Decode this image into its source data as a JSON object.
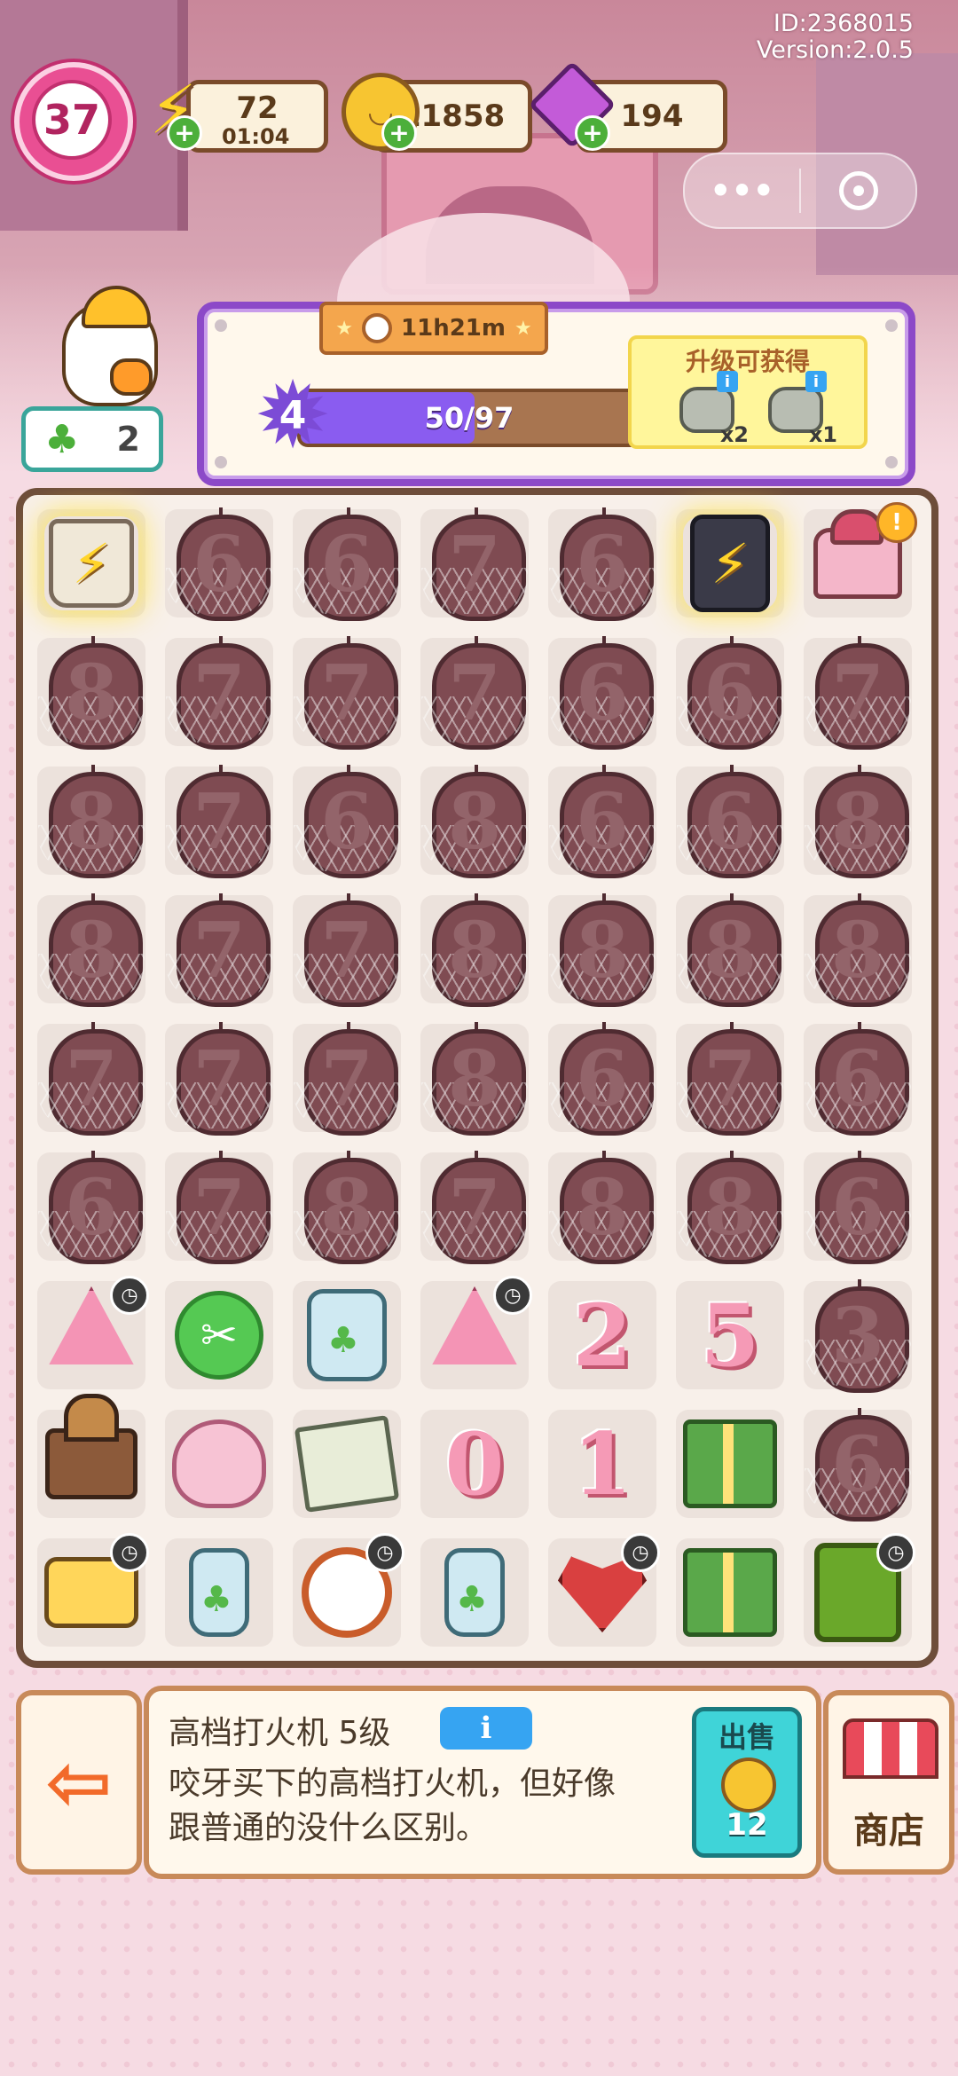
{
  "header": {
    "user_id": "ID:2368015",
    "version": "Version:2.0.5"
  },
  "player": {
    "level": "37"
  },
  "resources": {
    "energy": "72",
    "energy_timer": "01:04",
    "coins": "11858",
    "gems": "194",
    "plus_symbol": "+"
  },
  "capsule": {
    "more": "•••"
  },
  "helper": {
    "clover_count": "2"
  },
  "level_panel": {
    "timer": "11h21m",
    "level": "4",
    "xp_text": "50/97",
    "xp_progress": 0.515,
    "reward_title": "升级可获得",
    "rewards": [
      {
        "icon": "stone-icon",
        "qty": "x2"
      },
      {
        "icon": "stone-icon",
        "qty": "x1"
      }
    ]
  },
  "board": {
    "rows": [
      [
        "planter-generator",
        "6",
        "6",
        "7",
        "6",
        "lighter-generator",
        "cake"
      ],
      [
        "8",
        "7",
        "7",
        "7",
        "6",
        "6",
        "7"
      ],
      [
        "8",
        "7",
        "6",
        "8",
        "6",
        "6",
        "8"
      ],
      [
        "8",
        "7",
        "7",
        "8",
        "8",
        "8",
        "8"
      ],
      [
        "7",
        "7",
        "7",
        "8",
        "6",
        "7",
        "6"
      ],
      [
        "6",
        "7",
        "8",
        "7",
        "8",
        "8",
        "6"
      ],
      [
        "pink-tree",
        "scissors",
        "clover-jar",
        "pink-tree",
        "candle-2",
        "candle-5",
        "3"
      ],
      [
        "music-box",
        "blossom-tree",
        "photo-book",
        "candle-0",
        "candle-1",
        "green-pouch",
        "6"
      ],
      [
        "duck-scale",
        "clover-bottle",
        "alarm-clock",
        "clover-jar-small",
        "bandaged-heart",
        "green-gift",
        "lantern-clock"
      ]
    ],
    "candle_digits": {
      "candle-2": "2",
      "candle-5": "5",
      "candle-0": "0",
      "candle-1": "1"
    },
    "info_symbol": "i",
    "timer_symbol": "◷",
    "alert_symbol": "!"
  },
  "item_info": {
    "name": "高档打火机 5级",
    "info_label": "i",
    "description": "咬牙买下的高档打火机，但好像跟普通的没什么区别。",
    "sell_label": "出售",
    "sell_price": "12"
  },
  "shop": {
    "label": "商店"
  },
  "exit": {
    "icon": "exit-icon"
  },
  "colors": {
    "board_frame": "#6e4d3a",
    "panel_purple": "#8c49c8",
    "accent_teal": "#3fd4d8",
    "pink_bg": "#f6dbe3"
  }
}
